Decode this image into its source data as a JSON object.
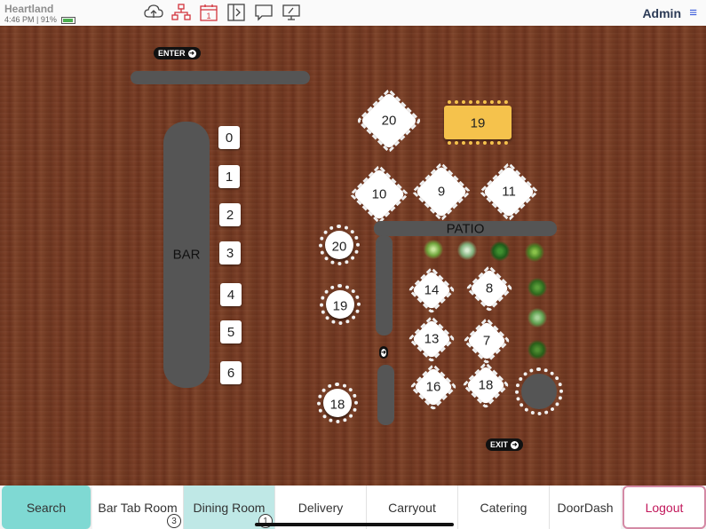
{
  "status_bar": {
    "brand": "Heartland",
    "time": "4:46 PM",
    "battery": "91%"
  },
  "header": {
    "icons": [
      "cloud-upload-icon",
      "org-chart-icon",
      "calendar-icon",
      "split-screen-icon",
      "chat-icon",
      "monitor-icon"
    ],
    "user": "Admin"
  },
  "floor": {
    "enter_label": "ENTER",
    "exit_label": "EXIT",
    "bar_label": "BAR",
    "patio_label": "PATIO",
    "bar_seats": [
      "0",
      "1",
      "2",
      "3",
      "4",
      "5",
      "6"
    ],
    "tables": {
      "t20_diamond": "20",
      "t19_rect": "19",
      "t10": "10",
      "t9": "9",
      "t11": "11",
      "t20_round": "20",
      "t19_round": "19",
      "t18_round": "18",
      "t14": "14",
      "t8": "8",
      "t13": "13",
      "t7": "7",
      "t16": "16",
      "t18_dia": "18"
    },
    "highlight_color": "#f5c24c"
  },
  "tabs": [
    {
      "label": "Search"
    },
    {
      "label": "Bar Tab Room",
      "badge": "3"
    },
    {
      "label": "Dining Room",
      "badge": "1"
    },
    {
      "label": "Delivery"
    },
    {
      "label": "Carryout"
    },
    {
      "label": "Catering"
    },
    {
      "label": "DoorDash"
    },
    {
      "label": "Logout"
    }
  ]
}
